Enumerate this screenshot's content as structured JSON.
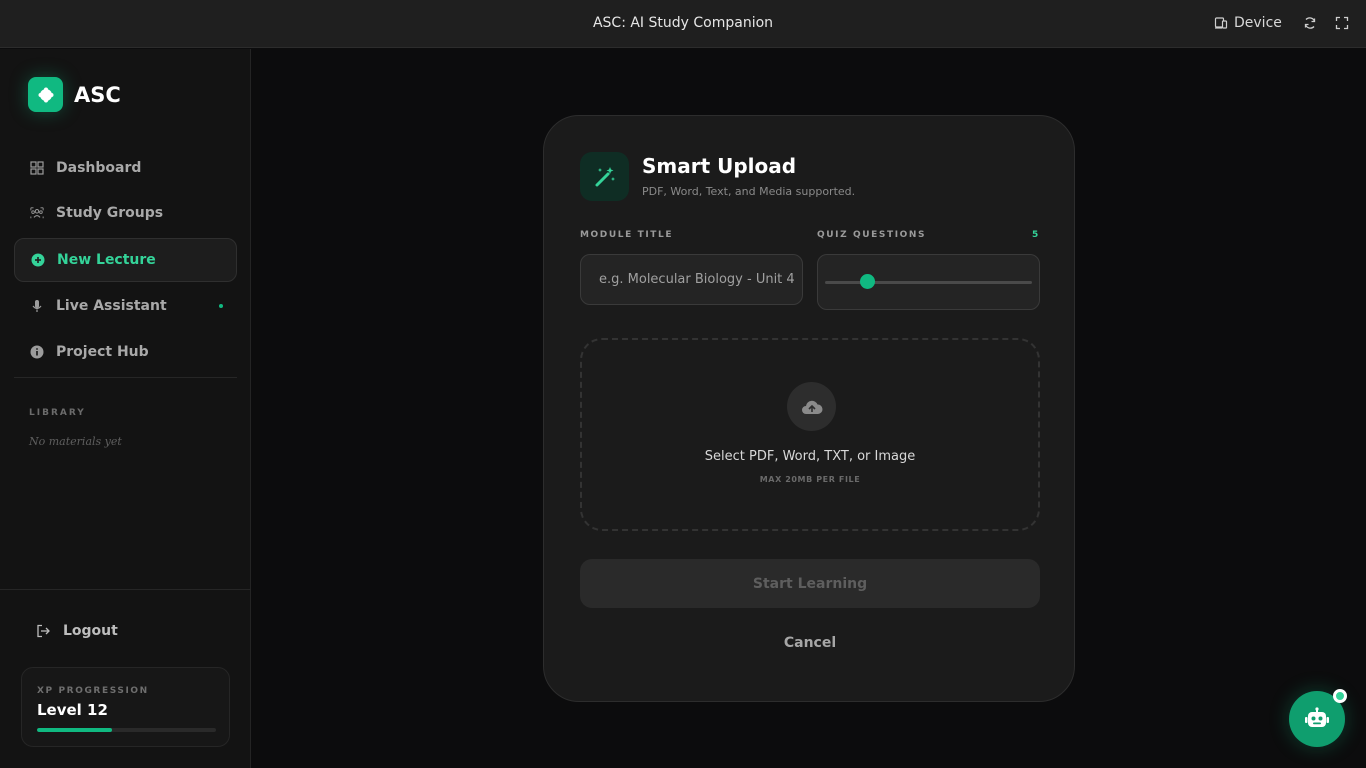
{
  "window": {
    "title": "ASC: AI Study Companion",
    "device_label": "Device"
  },
  "sidebar": {
    "brand": "ASC",
    "items": [
      {
        "label": "Dashboard",
        "icon": "grid-icon",
        "active": false
      },
      {
        "label": "Study Groups",
        "icon": "users-icon",
        "active": false
      },
      {
        "label": "New Lecture",
        "icon": "plus-circle-icon",
        "active": true
      },
      {
        "label": "Live Assistant",
        "icon": "microphone-icon",
        "active": false,
        "status": "live"
      },
      {
        "label": "Project Hub",
        "icon": "info-circle-icon",
        "active": false
      }
    ],
    "library_label": "LIBRARY",
    "library_empty": "No materials yet",
    "logout_label": "Logout",
    "xp": {
      "label": "XP PROGRESSION",
      "level": "Level 12",
      "progress": 0.42
    }
  },
  "modal": {
    "title": "Smart Upload",
    "subtitle": "PDF, Word, Text, and Media supported.",
    "module_title_label": "MODULE TITLE",
    "module_title_placeholder": "e.g. Molecular Biology - Unit 4",
    "module_title_value": "",
    "quiz_label": "QUIZ QUESTIONS",
    "quiz_value": "5",
    "quiz_slider_fraction": 0.2,
    "dropzone_text": "Select PDF, Word, TXT, or Image",
    "dropzone_sub": "MAX 20MB PER FILE",
    "start_label": "Start Learning",
    "cancel_label": "Cancel"
  },
  "colors": {
    "accent": "#10b981",
    "accent_light": "#34d399",
    "background": "#0c0c0d"
  }
}
